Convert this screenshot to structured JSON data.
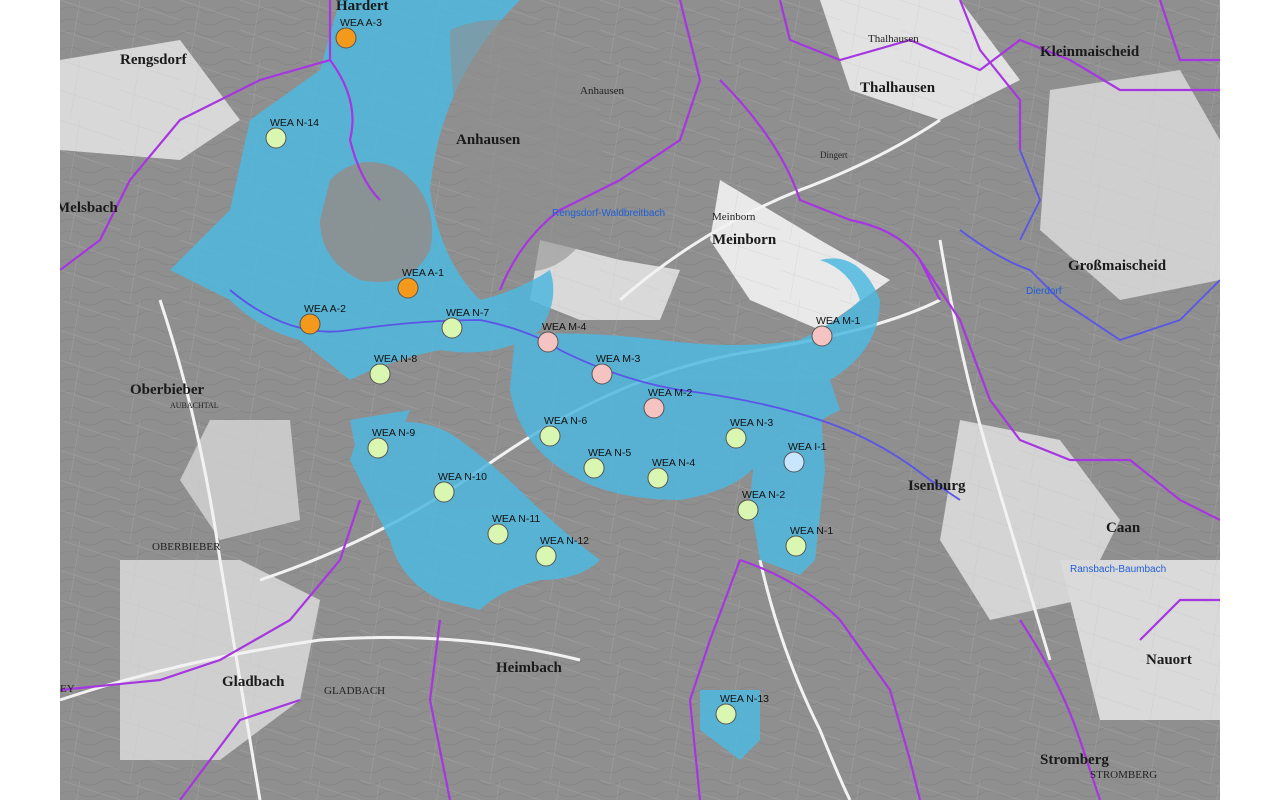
{
  "colors": {
    "background": "#8f8f8f",
    "area": "#4fb8df",
    "boundary": "#a636e0",
    "boundary_inner": "#5a55e8",
    "planned": "#d9f7b0",
    "approved": "#f39a1c",
    "m_group": "#f6c3c3",
    "i_group": "#c9e6ff"
  },
  "map": {
    "places": [
      {
        "name": "Hardert",
        "style": "town"
      },
      {
        "name": "Rengsdorf",
        "style": "town"
      },
      {
        "name": "Anhausen",
        "style": "town"
      },
      {
        "name": "Anhausen",
        "style": "town"
      },
      {
        "name": "Thalhausen",
        "style": "town-sm"
      },
      {
        "name": "Thalhausen",
        "style": "town"
      },
      {
        "name": "Kleinmaischeid",
        "style": "town"
      },
      {
        "name": "Melsbach",
        "style": "town"
      },
      {
        "name": "Meinborn",
        "style": "town-sm"
      },
      {
        "name": "Meinborn",
        "style": "town"
      },
      {
        "name": "Großmaischeid",
        "style": "town"
      },
      {
        "name": "Oberbieber",
        "style": "town"
      },
      {
        "name": "OBERBIEBER",
        "style": "town-sm"
      },
      {
        "name": "AUBACHTAL",
        "style": "town-sm"
      },
      {
        "name": "Isenburg",
        "style": "town"
      },
      {
        "name": "Caan",
        "style": "town"
      },
      {
        "name": "Heimbach",
        "style": "town"
      },
      {
        "name": "Gladbach",
        "style": "town"
      },
      {
        "name": "GLADBACH",
        "style": "town-sm"
      },
      {
        "name": "Nauort",
        "style": "town"
      },
      {
        "name": "Stromberg",
        "style": "town"
      },
      {
        "name": "STROMBERG",
        "style": "town-sm"
      },
      {
        "name": "EY",
        "style": "town-sm"
      },
      {
        "name": "Dingert",
        "style": "town-sm"
      }
    ],
    "blue_labels": [
      "Rengsdorf-Waldbreitbach",
      "Dierdorf",
      "Ransbach-Baumbach"
    ],
    "turbines": [
      {
        "id": "WEA A-3",
        "status": "approved"
      },
      {
        "id": "WEA N-14",
        "status": "planned"
      },
      {
        "id": "WEA A-1",
        "status": "approved"
      },
      {
        "id": "WEA A-2",
        "status": "approved"
      },
      {
        "id": "WEA N-7",
        "status": "planned"
      },
      {
        "id": "WEA M-4",
        "status": "m_group"
      },
      {
        "id": "WEA M-1",
        "status": "m_group"
      },
      {
        "id": "WEA M-3",
        "status": "m_group"
      },
      {
        "id": "WEA N-8",
        "status": "planned"
      },
      {
        "id": "WEA M-2",
        "status": "m_group"
      },
      {
        "id": "WEA N-6",
        "status": "planned"
      },
      {
        "id": "WEA N-3",
        "status": "planned"
      },
      {
        "id": "WEA N-9",
        "status": "planned"
      },
      {
        "id": "WEA I-1",
        "status": "i_group"
      },
      {
        "id": "WEA N-5",
        "status": "planned"
      },
      {
        "id": "WEA N-4",
        "status": "planned"
      },
      {
        "id": "WEA N-10",
        "status": "planned"
      },
      {
        "id": "WEA N-2",
        "status": "planned"
      },
      {
        "id": "WEA N-11",
        "status": "planned"
      },
      {
        "id": "WEA N-1",
        "status": "planned"
      },
      {
        "id": "WEA N-12",
        "status": "planned"
      },
      {
        "id": "WEA N-13",
        "status": "planned"
      }
    ]
  }
}
